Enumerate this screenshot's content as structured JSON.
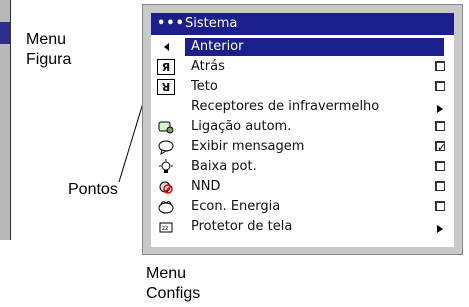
{
  "captions": {
    "menu_figura": "Menu\nFigura",
    "pontos": "Pontos",
    "menu_configs": "Menu\nConfigs"
  },
  "menu": {
    "header_dots": "•••",
    "title": "Sistema",
    "items": [
      {
        "label": "Anterior",
        "icon": "left-triangle",
        "control": "none",
        "selected": true
      },
      {
        "label": "Atrás",
        "icon": "rear-projection-icon",
        "control": "checkbox",
        "checked": false
      },
      {
        "label": "Teto",
        "icon": "ceiling-icon",
        "control": "checkbox",
        "checked": false
      },
      {
        "label": "Receptores de infravermelho",
        "icon": "none",
        "control": "submenu"
      },
      {
        "label": "Ligação autom.",
        "icon": "auto-connect-icon",
        "control": "checkbox",
        "checked": false
      },
      {
        "label": "Exibir mensagem",
        "icon": "message-icon",
        "control": "checkbox",
        "checked": true
      },
      {
        "label": "Baixa pot.",
        "icon": "lamp-icon",
        "control": "checkbox",
        "checked": false
      },
      {
        "label": "NND",
        "icon": "no-disturb-icon",
        "control": "checkbox",
        "checked": false
      },
      {
        "label": "Econ. Energia",
        "icon": "power-save-icon",
        "control": "checkbox",
        "checked": false
      },
      {
        "label": "Protetor de tela",
        "icon": "screensaver-icon",
        "control": "submenu"
      }
    ]
  },
  "colors": {
    "header_bg": "#1a1f8c",
    "highlight": "#1a1f8c",
    "frame": "#c9c9c9"
  }
}
